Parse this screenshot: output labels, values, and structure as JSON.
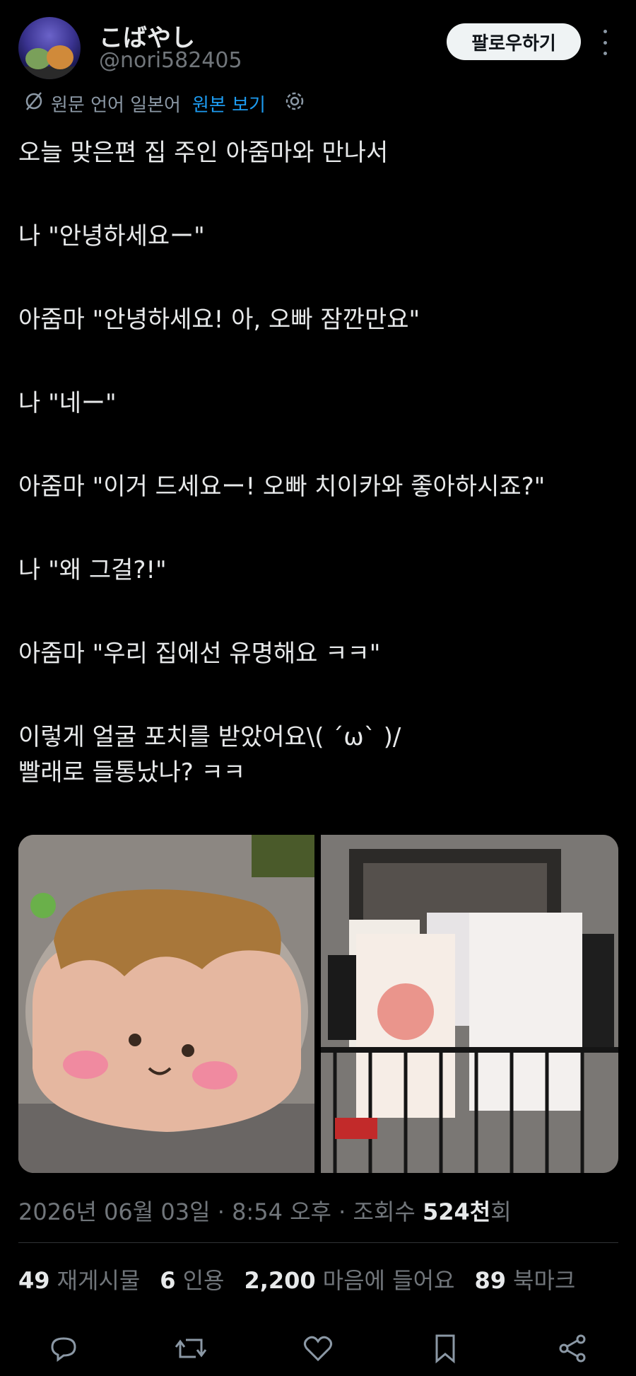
{
  "user": {
    "display_name": "こばやし",
    "handle": "@nori582405"
  },
  "header": {
    "follow_label": "팔로우하기",
    "more_icon": "more-vertical-icon"
  },
  "translation": {
    "source_language": "원문 언어 일본어",
    "view_original": "원본 보기",
    "icon": "translate-icon",
    "settings_icon": "gear-icon"
  },
  "tweet": {
    "lines": [
      "오늘 맞은편 집 주인 아줌마와 만나서",
      "나 \"안녕하세요ー\"",
      "아줌마 \"안녕하세요! 아, 오빠 잠깐만요\"",
      "나 \"네ー\"",
      "아줌마 \"이거 드세요ー! 오빠 치이카와 좋아하시죠?\"",
      "나 \"왜 그걸?!\"",
      "아줌마 \"우리 집에선 유명해요 ㅋㅋ\"",
      "이렇게 얼굴 포치를 받았어요\\( ´ω` )/",
      "빨래로 들통났나? ㅋㅋ"
    ]
  },
  "meta": {
    "date": "2026년 06월 03일",
    "time": "8:54 오후",
    "views_label": "조회수",
    "views_num": "524천",
    "views_suffix": "회"
  },
  "stats": {
    "retweets": "49",
    "retweets_label": "재게시물",
    "quotes": "6",
    "quotes_label": "인용",
    "likes": "2,200",
    "likes_label": "마음에 들어요",
    "bookmarks": "89",
    "bookmarks_label": "북마크"
  },
  "actions": [
    "reply-icon",
    "retweet-icon",
    "like-icon",
    "bookmark-icon",
    "share-icon"
  ],
  "colors": {
    "background": "#000000",
    "text": "#e7e9ea",
    "muted": "#71767b",
    "link": "#1d9bf0"
  }
}
